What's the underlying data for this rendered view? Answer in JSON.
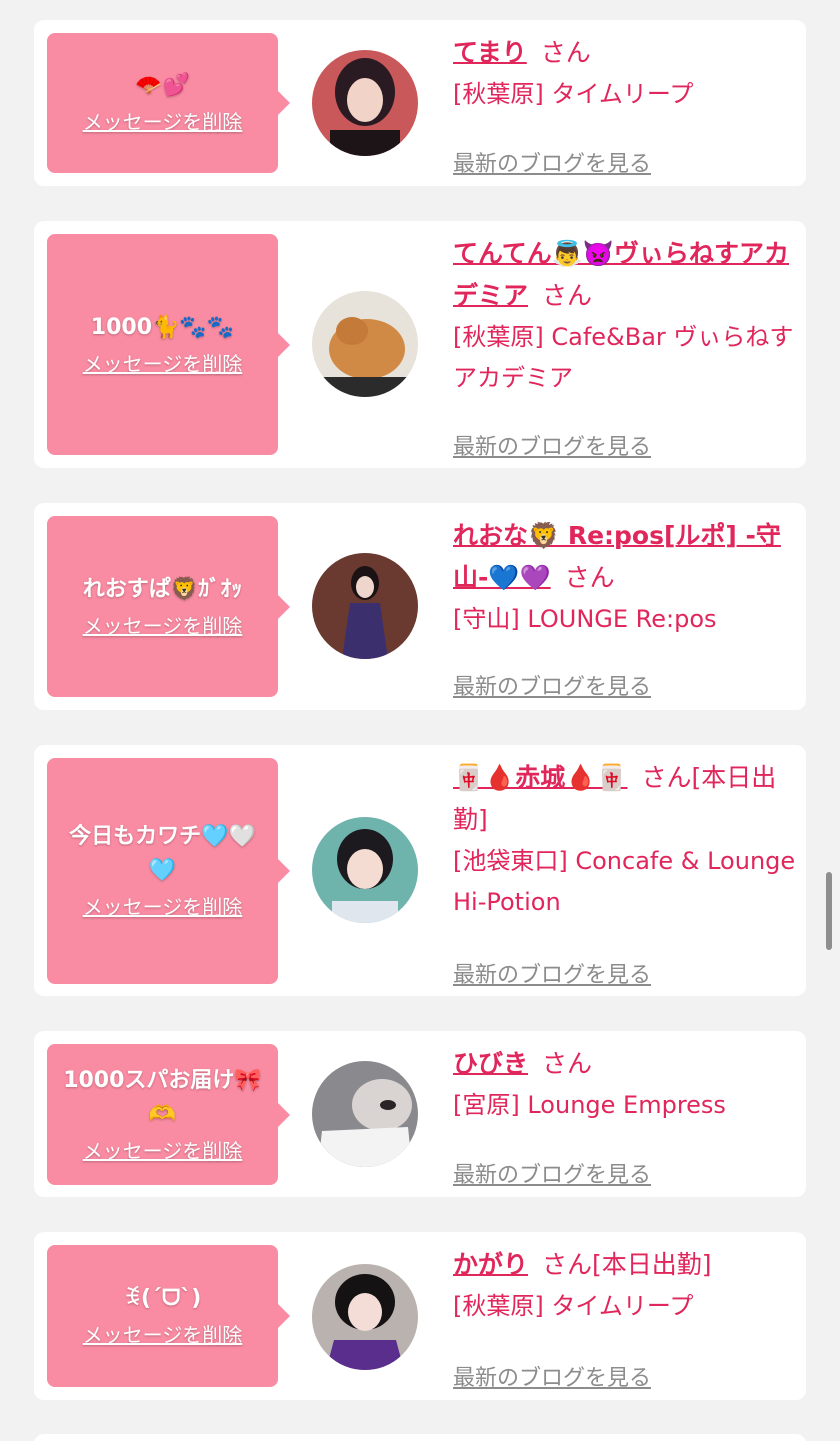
{
  "favorites": [
    {
      "message": "🪭💕",
      "delete_label": "メッセージを削除",
      "name": "てまり",
      "suffix": "さん",
      "shop": "[秋葉原] タイムリープ",
      "blog_label": "最新のブログを見る"
    },
    {
      "message": "1000🐈🐾🐾",
      "delete_label": "メッセージを削除",
      "name": "てんてん👼👿ヴぃらねすアカデミア",
      "suffix": "さん",
      "shop": "[秋葉原] Cafe&Bar ヴぃらねすアカデミア",
      "blog_label": "最新のブログを見る"
    },
    {
      "message": "れおすぱ🦁ｶﾞｵｯ",
      "delete_label": "メッセージを削除",
      "name": "れおな🦁 Re:pos[ルポ] -守山-💙💜",
      "suffix": "さん",
      "shop": "[守山] LOUNGE Re:pos",
      "blog_label": "最新のブログを見る"
    },
    {
      "message": "今日もカワチ🩵🤍🩵",
      "delete_label": "メッセージを削除",
      "name": "🀄🩸赤城🩸🀄",
      "suffix": "さん[本日出勤]",
      "shop": "[池袋東口] Concafe & Lounge Hi-Potion",
      "blog_label": "最新のブログを見る"
    },
    {
      "message": "1000スパお届け🎀🫶",
      "delete_label": "メッセージを削除",
      "name": "ひびき",
      "suffix": "さん",
      "shop": "[宮原] Lounge Empress",
      "blog_label": "最新のブログを見る"
    },
    {
      "message": "ꉂ(ˊᗜˋ)",
      "delete_label": "メッセージを削除",
      "name": "かがり",
      "suffix": "さん[本日出勤]",
      "shop": "[秋葉原] タイムリープ",
      "blog_label": "最新のブログを見る"
    }
  ],
  "colors": {
    "bubble": "#f98ba2",
    "accent": "#e0265b",
    "link_gray": "#8c8c8c",
    "background": "#f2f2f2"
  }
}
